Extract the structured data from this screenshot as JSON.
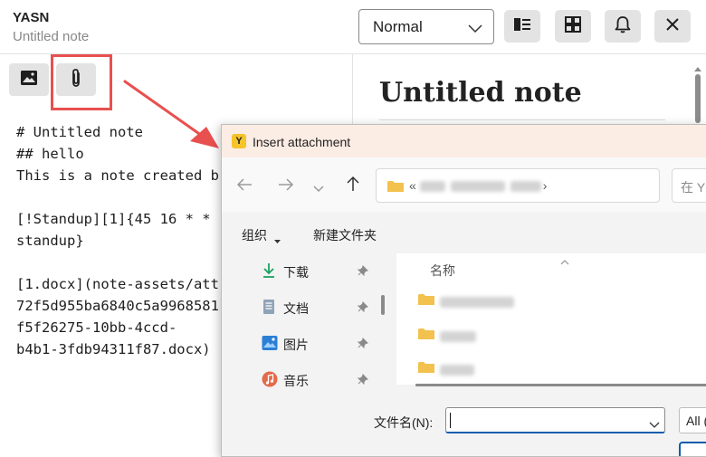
{
  "app": {
    "title": "YASN",
    "subtitle": "Untitled note"
  },
  "header": {
    "mode_select": {
      "value": "Normal",
      "icon": "chevron-down-icon"
    },
    "buttons": [
      {
        "icon": "split-view-icon"
      },
      {
        "icon": "grid-layout-icon"
      },
      {
        "icon": "bell-icon"
      },
      {
        "icon": "close-icon"
      }
    ]
  },
  "toolbar": {
    "buttons": [
      {
        "icon": "image-icon"
      },
      {
        "icon": "paperclip-icon"
      }
    ],
    "highlight_color": "#e8504f"
  },
  "editor": {
    "lines": [
      "# Untitled note",
      "## hello",
      "This is a note created b",
      "",
      "[!Standup][1]{45 16 * *",
      "standup}",
      "",
      "[1.docx](note-assets/att",
      "72f5d955ba6840c5a9968581",
      "f5f26275-10bb-4ccd-",
      "b4b1-3fdb94311f87.docx)"
    ]
  },
  "preview": {
    "title": "Untitled note"
  },
  "dialog": {
    "title": "Insert attachment",
    "app_icon_letter": "Y",
    "address": {
      "prefix": "«",
      "suffix": "›"
    },
    "search_placeholder": "在 Y",
    "commands": {
      "organize": "组织",
      "new_folder": "新建文件夹"
    },
    "sidebar": [
      {
        "label": "下载",
        "icon": "download-icon",
        "pinned": true
      },
      {
        "label": "文档",
        "icon": "document-icon",
        "pinned": true
      },
      {
        "label": "图片",
        "icon": "pictures-icon",
        "pinned": true
      },
      {
        "label": "音乐",
        "icon": "music-icon",
        "pinned": true
      }
    ],
    "file_list": {
      "column_name": "名称",
      "rows": [
        {
          "icon": "folder-icon"
        },
        {
          "icon": "folder-icon"
        },
        {
          "icon": "folder-icon"
        }
      ]
    },
    "footer": {
      "filename_label": "文件名(N):",
      "filename_value": "",
      "file_type": "All (",
      "accent": "#0b5cad"
    }
  }
}
